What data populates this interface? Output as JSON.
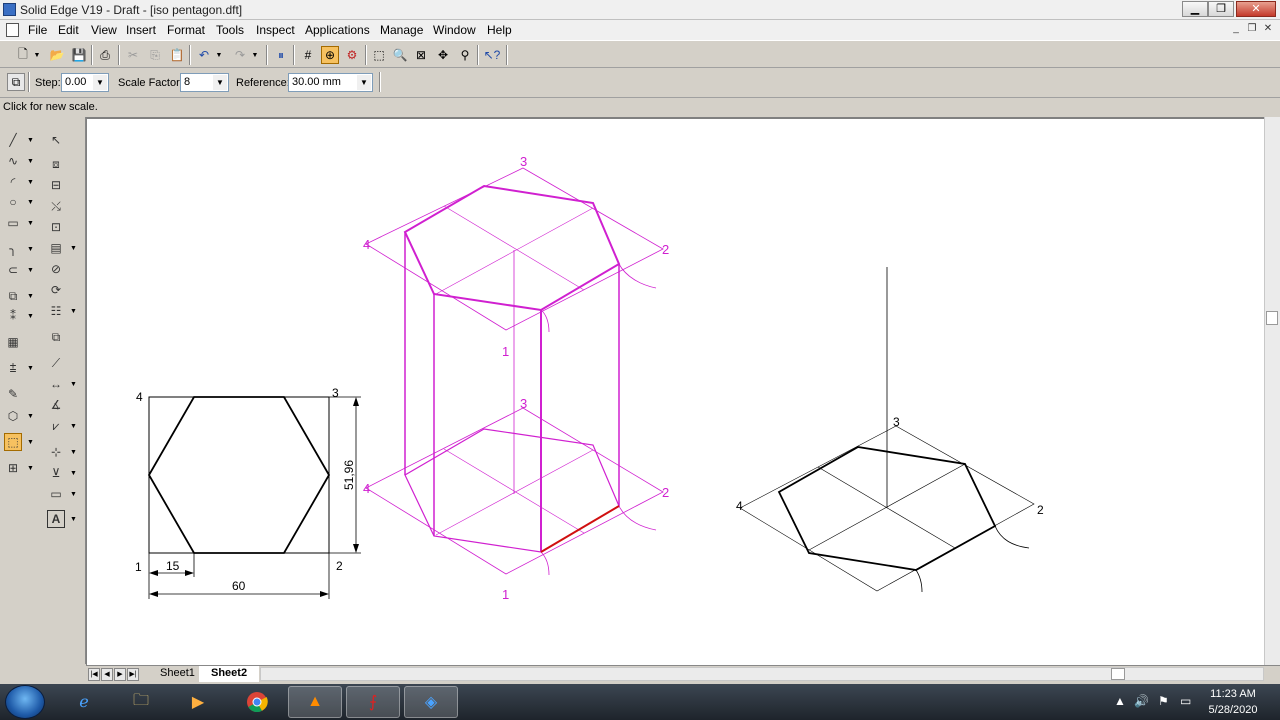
{
  "window": {
    "title": "Solid Edge V19 - Draft - [iso pentagon.dft]"
  },
  "menu": [
    "File",
    "Edit",
    "View",
    "Insert",
    "Format",
    "Tools",
    "Inspect",
    "Applications",
    "Manage",
    "Window",
    "Help"
  ],
  "scale_bar": {
    "step_label": "Step:",
    "step_value": "0.00",
    "scale_label": "Scale Factor:",
    "scale_value": "8",
    "reference_label": "Reference:",
    "reference_value": "30.00 mm"
  },
  "prompt": "Click for new scale.",
  "sheets": [
    "Sheet1",
    "Sheet2"
  ],
  "active_sheet": "Sheet2",
  "drawing": {
    "ortho_view": {
      "corner_labels": [
        "4",
        "3",
        "1",
        "2"
      ],
      "dim_height": "51,96",
      "dim_offset": "15",
      "dim_width": "60"
    },
    "prism_view": {
      "labels": [
        "3",
        "4",
        "2",
        "1",
        "3",
        "4",
        "2",
        "1"
      ]
    },
    "iso_view": {
      "labels": [
        "3",
        "4",
        "2"
      ]
    },
    "colors": {
      "construction": "#d020d0",
      "edge": "#000000",
      "highlight": "#d01010"
    }
  },
  "taskbar": {
    "apps": [
      "ie-icon",
      "explorer-icon",
      "media-player-icon",
      "chrome-icon",
      "vlc-icon",
      "acrobat-icon",
      "solid-edge-icon"
    ],
    "time": "11:23 AM",
    "date": "5/28/2020"
  }
}
